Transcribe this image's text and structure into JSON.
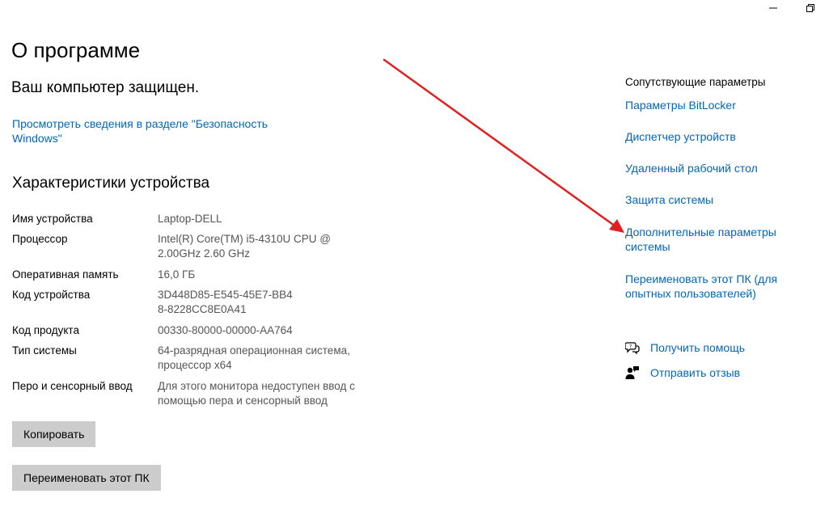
{
  "page": {
    "title": "О программе",
    "protected_status": "Ваш компьютер защищен.",
    "security_link": "Просмотреть сведения в разделе \"Безопасность Windows\""
  },
  "device": {
    "heading": "Характеристики устройства",
    "specs": [
      {
        "label": "Имя устройства",
        "value": "Laptop-DELL"
      },
      {
        "label": "Процессор",
        "value": "Intel(R) Core(TM) i5-4310U CPU @ 2.00GHz 2.60 GHz"
      },
      {
        "label": "Оперативная память",
        "value": "16,0 ГБ"
      },
      {
        "label": "Код устройства",
        "value": "3D448D85-E545-45E7-BB48-8228CC8E0A41"
      },
      {
        "label": "Код продукта",
        "value": "00330-80000-00000-AA764"
      },
      {
        "label": "Тип системы",
        "value": "64-разрядная операционная система, процессор x64"
      },
      {
        "label": "Перо и сенсорный ввод",
        "value": "Для этого монитора недоступен ввод с помощью пера и сенсорный ввод"
      }
    ]
  },
  "buttons": {
    "copy": "Копировать",
    "rename": "Переименовать этот ПК"
  },
  "related": {
    "title": "Сопутствующие параметры",
    "links": [
      "Параметры BitLocker",
      "Диспетчер устройств",
      "Удаленный рабочий стол",
      "Защита системы",
      "Дополнительные параметры системы",
      "Переименовать этот ПК (для опытных пользователей)"
    ]
  },
  "help": {
    "get_help": "Получить помощь",
    "feedback": "Отправить отзыв"
  },
  "icons": {
    "minimize": "minimize-icon",
    "restore": "restore-icon",
    "get_help": "help-chat-icon",
    "feedback": "feedback-person-icon"
  },
  "colors": {
    "link": "#0067b8",
    "button_bg": "#cccccc",
    "annotation_arrow": "#e02020"
  }
}
